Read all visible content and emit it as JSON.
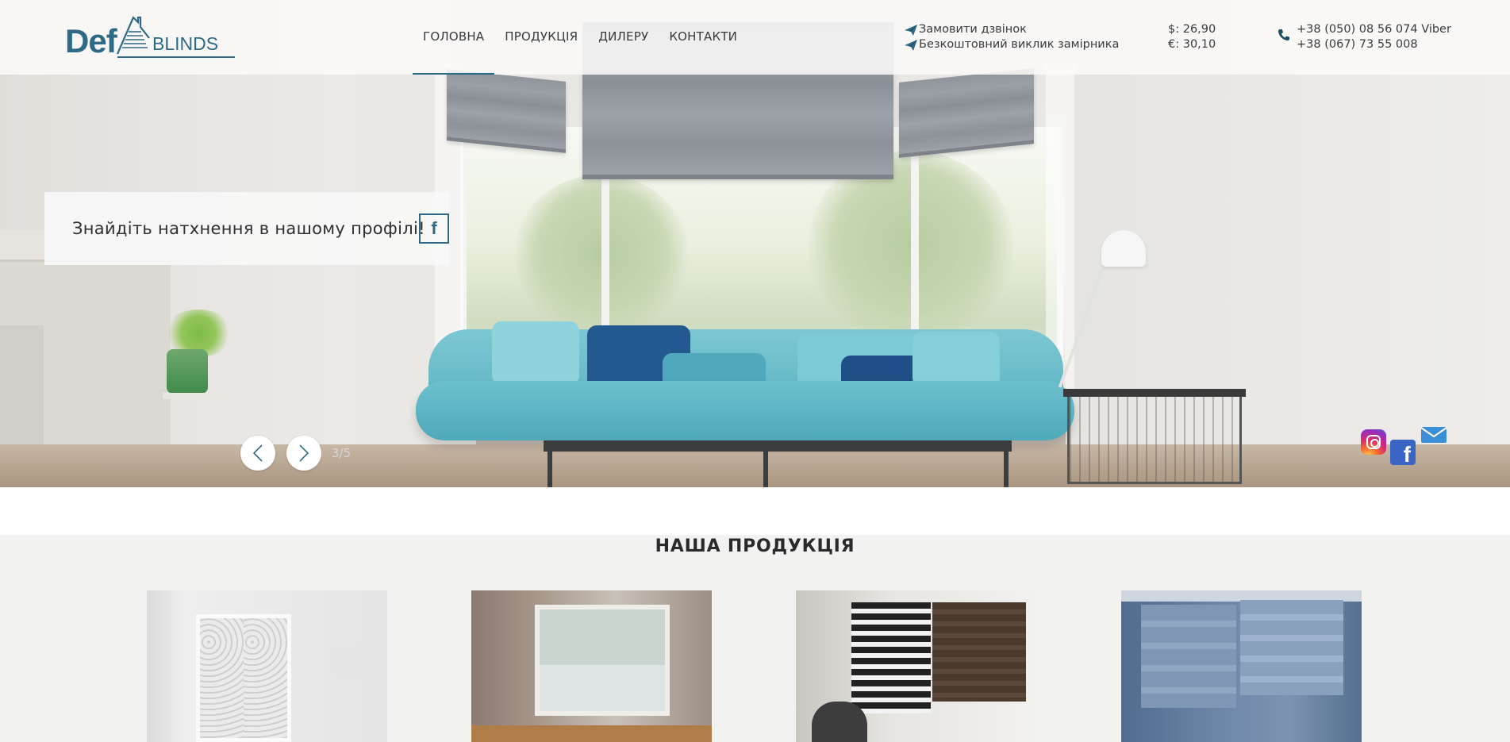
{
  "header": {
    "logo_def": "Def",
    "logo_blinds": "BLINDS",
    "nav": [
      {
        "label": "ГОЛОВНА",
        "active": true
      },
      {
        "label": "ПРОДУКЦІЯ",
        "active": false
      },
      {
        "label": "ДИЛЕРУ",
        "active": false
      },
      {
        "label": "КОНТАКТИ",
        "active": false
      }
    ],
    "cta": {
      "order_call": "Замовити дзвінок",
      "free_measure": "Безкоштовний виклик замірника"
    },
    "rates": {
      "usd": "$: 26,90",
      "eur": "€: 30,10"
    },
    "phones": {
      "phone1": "+38 (050) 08 56 074 Viber",
      "phone2": "+38 (067) 73 55 008"
    }
  },
  "slider": {
    "caption": "Знайдіть натхнення в нашому профілі!",
    "fb_letter": "f",
    "counter": "3/5"
  },
  "social": {
    "fb_letter": "f"
  },
  "products": {
    "title": "НАША ПРОДУКЦІЯ"
  },
  "colors": {
    "brand": "#2e6a86",
    "instagram": "#d62976",
    "facebook": "#3a65c4",
    "mail": "#3b8ed8"
  }
}
